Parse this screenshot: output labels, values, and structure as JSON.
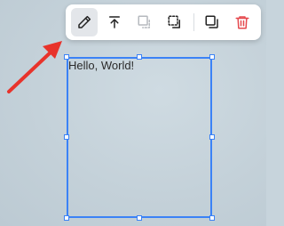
{
  "canvas": {
    "text_element": "Hello, World!"
  },
  "toolbar": {
    "buttons": [
      {
        "name": "edit-button",
        "icon": "pencil-icon",
        "state": "active"
      },
      {
        "name": "bring-to-front-button",
        "icon": "arrow-up-to-line-icon",
        "state": "enabled"
      },
      {
        "name": "send-to-back-button",
        "icon": "layers-back-icon",
        "state": "disabled"
      },
      {
        "name": "send-backward-button",
        "icon": "layers-backward-icon",
        "state": "enabled"
      },
      {
        "name": "duplicate-button",
        "icon": "copy-icon",
        "state": "enabled"
      },
      {
        "name": "delete-button",
        "icon": "trash-icon",
        "state": "enabled"
      }
    ]
  },
  "colors": {
    "selection": "#3b82f6",
    "annotation_arrow": "#e8332b",
    "delete": "#e5484d",
    "disabled_icon": "#b5b9be",
    "icon": "#222222"
  }
}
